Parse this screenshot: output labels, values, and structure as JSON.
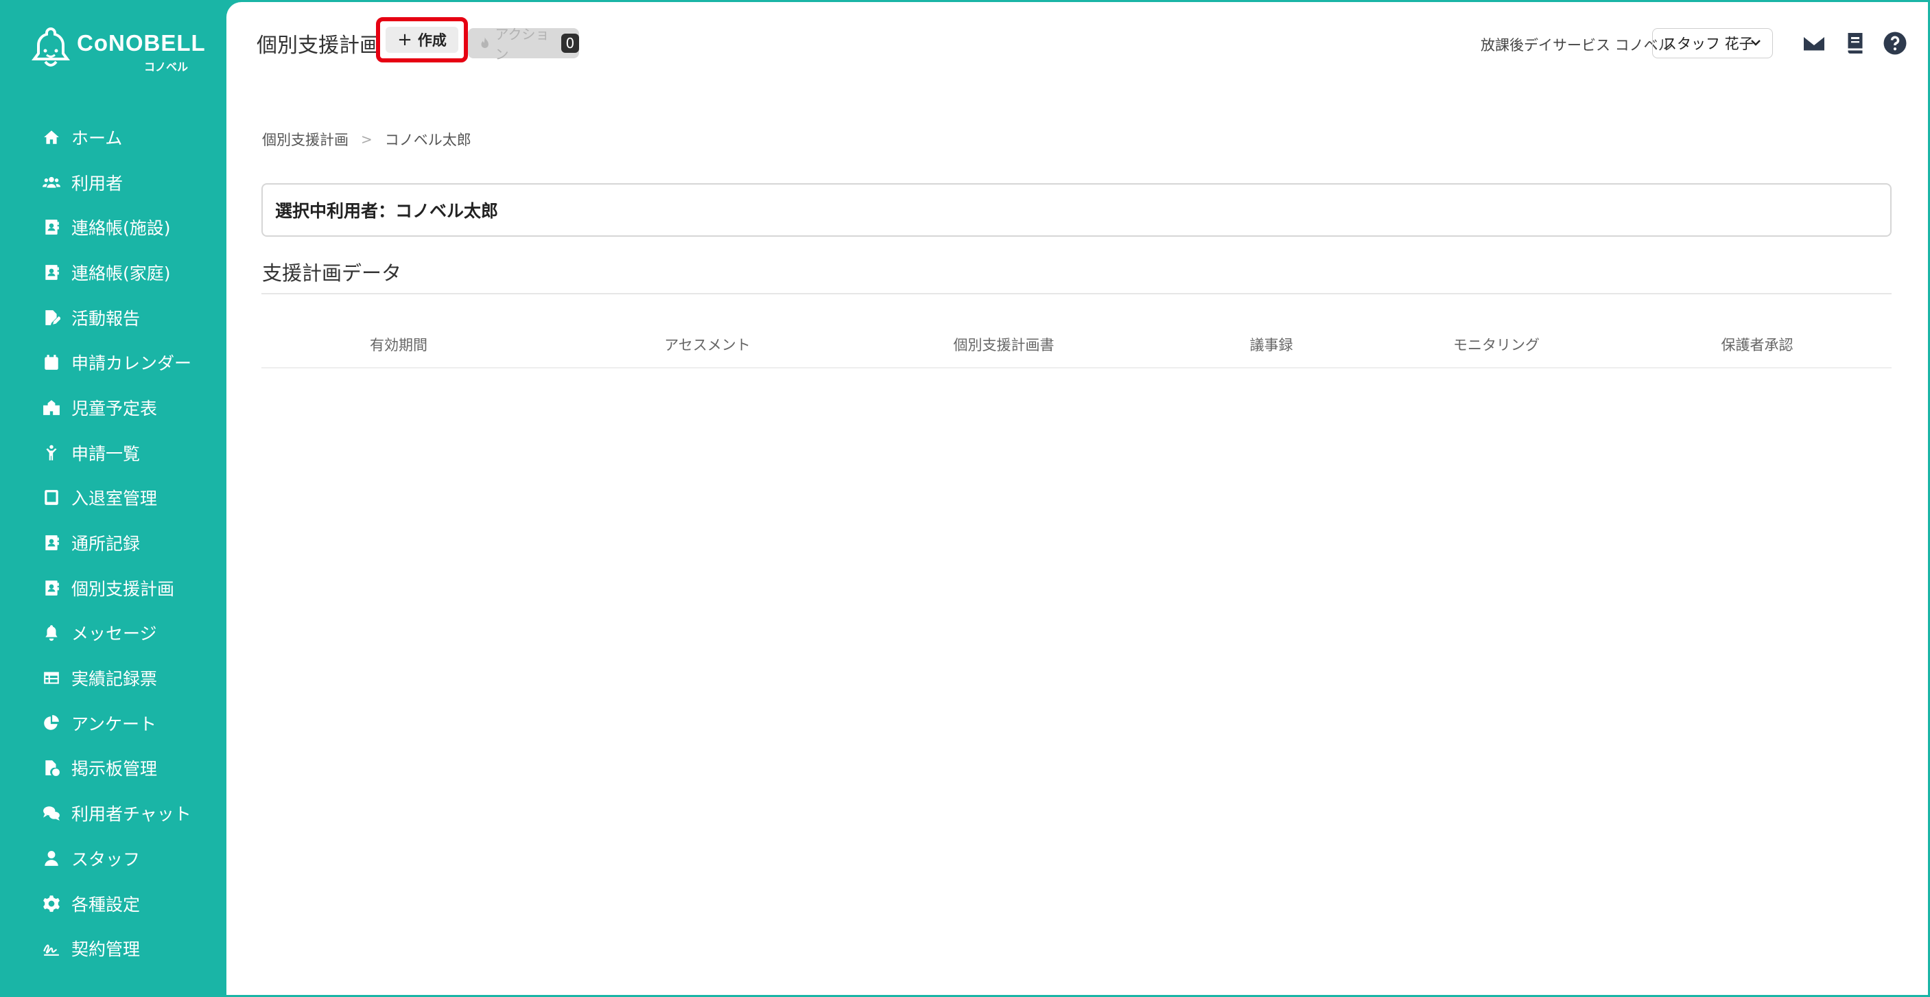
{
  "app": {
    "logo_text": "CoNOBELL",
    "logo_sub": "コノベル"
  },
  "sidebar": {
    "items": [
      {
        "label": "ホーム",
        "icon": "home-icon"
      },
      {
        "label": "利用者",
        "icon": "users-icon"
      },
      {
        "label": "連絡帳(施設)",
        "icon": "contact-book-icon"
      },
      {
        "label": "連絡帳(家庭)",
        "icon": "contact-book-icon"
      },
      {
        "label": "活動報告",
        "icon": "report-edit-icon"
      },
      {
        "label": "申請カレンダー",
        "icon": "calendar-icon"
      },
      {
        "label": "児童予定表",
        "icon": "school-icon"
      },
      {
        "label": "申請一覧",
        "icon": "child-icon"
      },
      {
        "label": "入退室管理",
        "icon": "tablet-icon"
      },
      {
        "label": "通所記録",
        "icon": "contact-book-icon"
      },
      {
        "label": "個別支援計画",
        "icon": "contact-book-icon"
      },
      {
        "label": "メッセージ",
        "icon": "bell-icon"
      },
      {
        "label": "実績記録票",
        "icon": "table-icon"
      },
      {
        "label": "アンケート",
        "icon": "pie-chart-icon"
      },
      {
        "label": "掲示板管理",
        "icon": "file-check-icon"
      },
      {
        "label": "利用者チャット",
        "icon": "chat-icon"
      },
      {
        "label": "スタッフ",
        "icon": "person-icon"
      },
      {
        "label": "各種設定",
        "icon": "gear-icon"
      },
      {
        "label": "契約管理",
        "icon": "signature-icon"
      }
    ]
  },
  "header": {
    "title": "個別支援計画",
    "create_label": "作成",
    "action_label": "アクション",
    "action_count": "0",
    "facility": "放課後デイサービス コノベル",
    "staff_selected": "スタッフ 花子"
  },
  "breadcrumb": {
    "root": "個別支援計画",
    "current": "コノベル太郎"
  },
  "selected_user": "選択中利用者：コノベル太郎",
  "section": {
    "title": "支援計画データ"
  },
  "table": {
    "columns": [
      "有効期間",
      "アセスメント",
      "個別支援計画書",
      "議事録",
      "モニタリング",
      "保護者承認"
    ]
  },
  "colors": {
    "accent": "#1ab5a6",
    "highlight": "#e60012"
  }
}
